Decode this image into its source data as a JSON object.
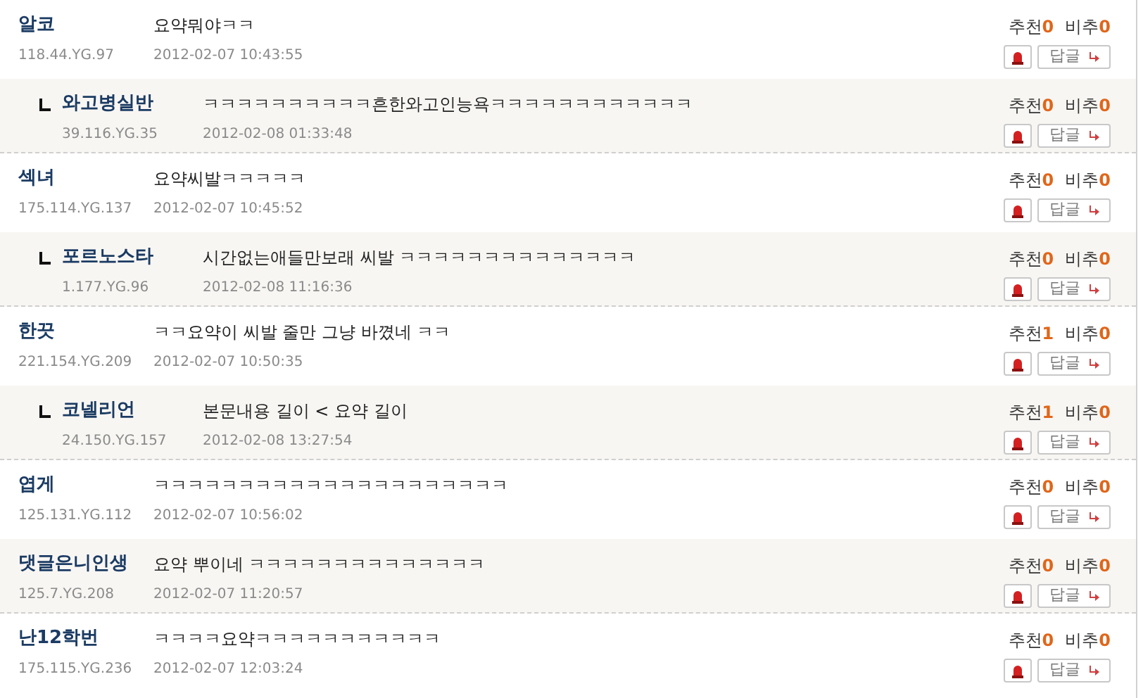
{
  "comments": [
    {
      "kind": "comment",
      "shaded": false,
      "author": "알코",
      "ip": "118.44.YG.97",
      "text": "요약뭐야ㅋㅋ",
      "date": "2012-02-07 10:43:55",
      "up_label": "추천",
      "up": "0",
      "down_label": "비추",
      "down": "0",
      "reply_button": "답글"
    },
    {
      "kind": "reply",
      "shaded": true,
      "author": "와고병실반",
      "ip": "39.116.YG.35",
      "text": "ㅋㅋㅋㅋㅋㅋㅋㅋㅋㅋ흔한와고인능욕ㅋㅋㅋㅋㅋㅋㅋㅋㅋㅋㅋㅋ",
      "date": "2012-02-08 01:33:48",
      "up_label": "추천",
      "up": "0",
      "down_label": "비추",
      "down": "0",
      "reply_button": "답글"
    },
    {
      "kind": "comment",
      "shaded": false,
      "author": "섹녀",
      "ip": "175.114.YG.137",
      "text": "요약씨발ㅋㅋㅋㅋㅋ",
      "date": "2012-02-07 10:45:52",
      "up_label": "추천",
      "up": "0",
      "down_label": "비추",
      "down": "0",
      "reply_button": "답글"
    },
    {
      "kind": "reply",
      "shaded": true,
      "author": "포르노스타",
      "ip": "1.177.YG.96",
      "text": "시간없는애들만보래 씨발 ㅋㅋㅋㅋㅋㅋㅋㅋㅋㅋㅋㅋㅋㅋ",
      "date": "2012-02-08 11:16:36",
      "up_label": "추천",
      "up": "0",
      "down_label": "비추",
      "down": "0",
      "reply_button": "답글"
    },
    {
      "kind": "comment",
      "shaded": false,
      "author": "한끗",
      "ip": "221.154.YG.209",
      "text": "ㅋㅋ요약이 씨발 줄만 그냥 바꼈네 ㅋㅋ",
      "date": "2012-02-07 10:50:35",
      "up_label": "추천",
      "up": "1",
      "down_label": "비추",
      "down": "0",
      "reply_button": "답글"
    },
    {
      "kind": "reply",
      "shaded": true,
      "author": "코넬리언",
      "ip": "24.150.YG.157",
      "text": "본문내용 길이 < 요약 길이",
      "date": "2012-02-08 13:27:54",
      "up_label": "추천",
      "up": "1",
      "down_label": "비추",
      "down": "0",
      "reply_button": "답글"
    },
    {
      "kind": "comment",
      "shaded": false,
      "author": "엽게",
      "ip": "125.131.YG.112",
      "text": "ㅋㅋㅋㅋㅋㅋㅋㅋㅋㅋㅋㅋㅋㅋㅋㅋㅋㅋㅋㅋㅋ",
      "date": "2012-02-07 10:56:02",
      "up_label": "추천",
      "up": "0",
      "down_label": "비추",
      "down": "0",
      "reply_button": "답글"
    },
    {
      "kind": "comment",
      "shaded": true,
      "author": "댓글은니인생",
      "ip": "125.7.YG.208",
      "text": "요약 뿌이네 ㅋㅋㅋㅋㅋㅋㅋㅋㅋㅋㅋㅋㅋㅋ",
      "date": "2012-02-07 11:20:57",
      "up_label": "추천",
      "up": "0",
      "down_label": "비추",
      "down": "0",
      "reply_button": "답글"
    },
    {
      "kind": "comment",
      "shaded": false,
      "author": "난12학번",
      "ip": "175.115.YG.236",
      "text": "ㅋㅋㅋㅋ요약ㅋㅋㅋㅋㅋㅋㅋㅋㅋㅋㅋ",
      "date": "2012-02-07 12:03:24",
      "up_label": "추천",
      "up": "0",
      "down_label": "비추",
      "down": "0",
      "reply_button": "답글"
    }
  ]
}
